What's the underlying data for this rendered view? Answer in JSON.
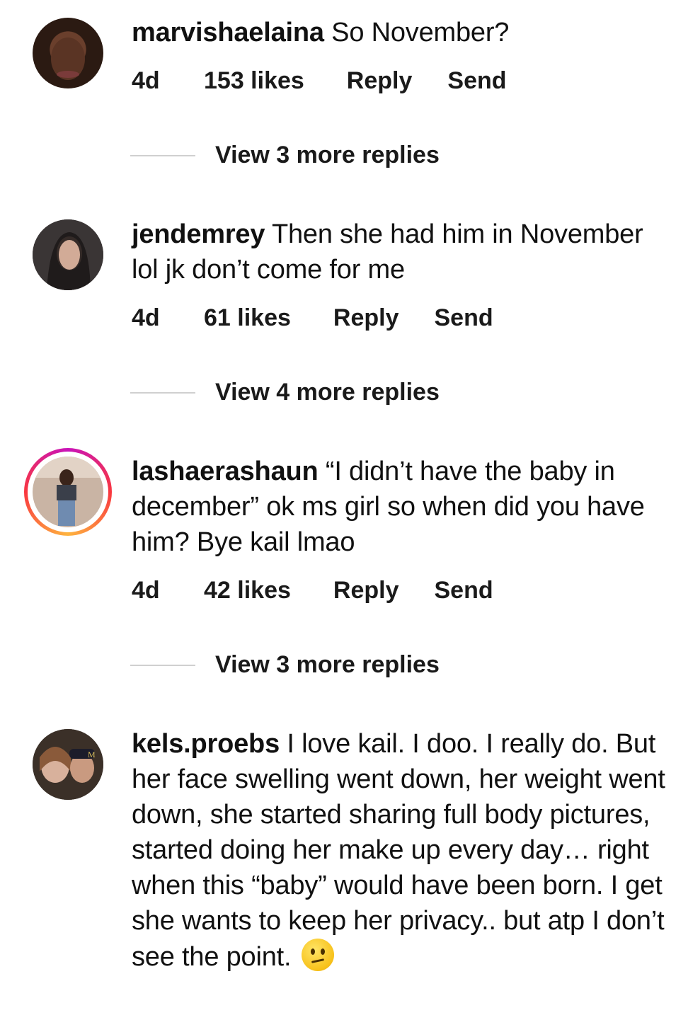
{
  "comments": [
    {
      "username": "marvishaelaina",
      "text": "So November?",
      "time": "4d",
      "likes": "153 likes",
      "reply": "Reply",
      "send": "Send",
      "view_replies": "View 3 more replies"
    },
    {
      "username": "jendemrey",
      "text": "Then she had  him in November lol jk don’t come for me",
      "time": "4d",
      "likes": "61 likes",
      "reply": "Reply",
      "send": "Send",
      "view_replies": "View 4 more replies"
    },
    {
      "username": "lashaerashaun",
      "text": "“I didn’t have the baby in december” ok ms girl so when did you have him? Bye kail lmao",
      "time": "4d",
      "likes": "42 likes",
      "reply": "Reply",
      "send": "Send",
      "view_replies": "View 3 more replies",
      "has_story_ring": true
    },
    {
      "username": "kels.proebs",
      "text": "I love kail. I doo. I really do. But her face swelling went down, her weight went down, she started sharing full body pictures, started doing her make up every day… right when this “baby” would have been born. I get she wants to keep her privacy.. but atp I don’t see the point.",
      "emoji": "confused-face"
    }
  ]
}
